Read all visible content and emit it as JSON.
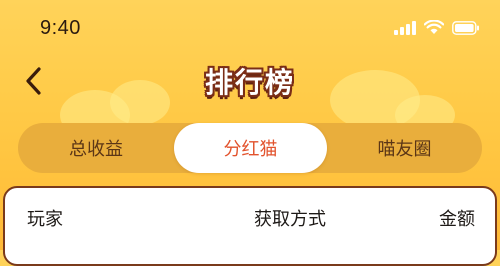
{
  "status_bar": {
    "time": "9:40",
    "icons": [
      "signal-icon",
      "wifi-icon",
      "battery-icon"
    ]
  },
  "nav": {
    "back_icon": "chevron-left-icon",
    "title": "排行榜"
  },
  "tabs": [
    {
      "label": "总收益",
      "active": false
    },
    {
      "label": "分红猫",
      "active": true
    },
    {
      "label": "喵友圈",
      "active": false
    }
  ],
  "table": {
    "columns": [
      "玩家",
      "获取方式",
      "金额"
    ]
  },
  "colors": {
    "background_top": "#FFD35A",
    "background_bottom": "#FFB938",
    "tab_track": "#E9AE3C",
    "tab_active_bg": "#FFFFFF",
    "tab_active_text": "#E2532D",
    "tab_inactive_text": "#5B3616",
    "title_outline": "#7A2D16",
    "card_border": "#7A3A1B"
  }
}
